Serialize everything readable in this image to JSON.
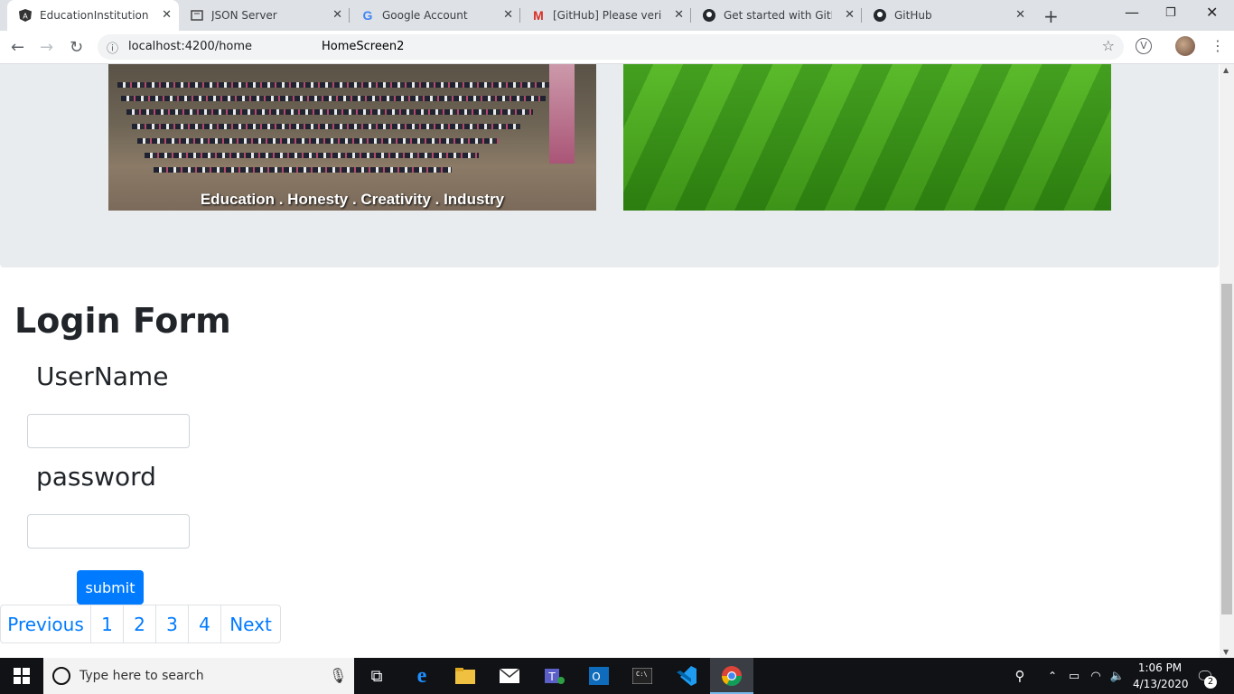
{
  "browser": {
    "tabs": [
      {
        "title": "EducationInstitution",
        "icon": "angular-icon"
      },
      {
        "title": "JSON Server",
        "icon": "json-server-icon"
      },
      {
        "title": "Google Account",
        "icon": "google-icon"
      },
      {
        "title": "[GitHub] Please verify y",
        "icon": "gmail-icon"
      },
      {
        "title": "Get started with GitHub",
        "icon": "github-icon"
      },
      {
        "title": "GitHub",
        "icon": "github-icon"
      }
    ],
    "url": "localhost:4200/home",
    "page_title": "HomeScreen2"
  },
  "page": {
    "motto": "Education . Honesty . Creativity . Industry",
    "login": {
      "title": "Login Form",
      "username_label": "UserName",
      "password_label": "password",
      "username_value": "",
      "password_value": "",
      "submit_label": "submit"
    },
    "pagination": [
      "Previous",
      "1",
      "2",
      "3",
      "4",
      "Next"
    ]
  },
  "taskbar": {
    "search_placeholder": "Type here to search",
    "time": "1:06 PM",
    "date": "4/13/2020",
    "notification_count": "2"
  },
  "colors": {
    "primary": "#007bff",
    "banner_bg": "#e9ecef",
    "taskbar": "#101216"
  }
}
